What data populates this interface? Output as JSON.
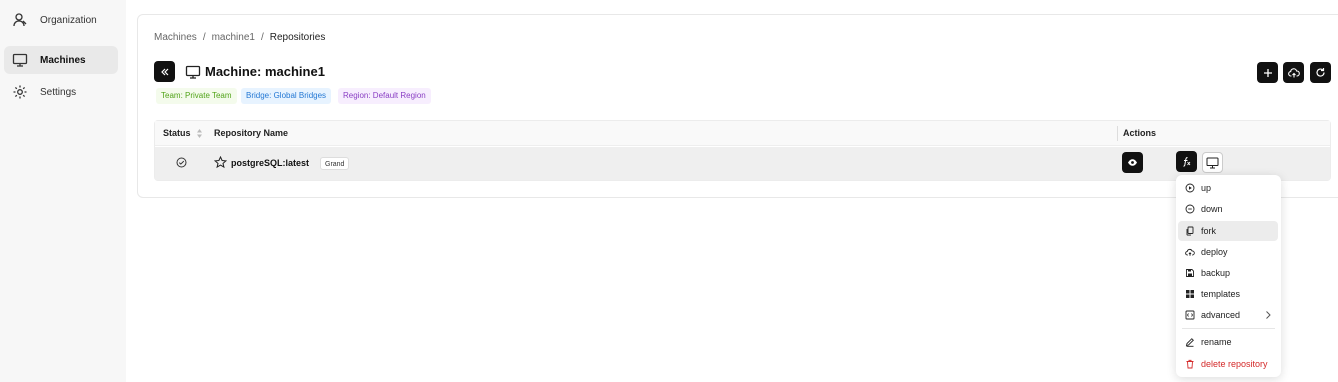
{
  "sidebar": {
    "items": [
      {
        "label": "Organization",
        "icon": "organization-icon",
        "active": false
      },
      {
        "label": "Machines",
        "icon": "monitor-icon",
        "active": true
      },
      {
        "label": "Settings",
        "icon": "gear-icon",
        "active": false
      }
    ]
  },
  "breadcrumb": {
    "items": [
      "Machines",
      "machine1",
      "Repositories"
    ],
    "separator": "/"
  },
  "header": {
    "title": "Machine: machine1",
    "tags": {
      "team": "Team: Private Team",
      "bridge": "Bridge: Global Bridges",
      "region": "Region: Default Region"
    },
    "buttons": [
      "add-icon",
      "cloud-upload-icon",
      "refresh-icon"
    ]
  },
  "table": {
    "columns": {
      "status": "Status",
      "name": "Repository Name",
      "actions": "Actions"
    },
    "rows": [
      {
        "name": "postgreSQL:latest",
        "badge": "Grand",
        "status_icon": "check-circle-icon"
      }
    ]
  },
  "menu": {
    "items": [
      {
        "label": "up",
        "icon": "play-circle-icon"
      },
      {
        "label": "down",
        "icon": "pause-circle-icon"
      },
      {
        "label": "fork",
        "icon": "copy-icon",
        "highlighted": true
      },
      {
        "label": "deploy",
        "icon": "cloud-icon"
      },
      {
        "label": "backup",
        "icon": "save-icon"
      },
      {
        "label": "templates",
        "icon": "grid-icon"
      },
      {
        "label": "advanced",
        "icon": "code-icon",
        "submenu": true
      },
      {
        "label": "rename",
        "icon": "edit-icon"
      },
      {
        "label": "delete repository",
        "icon": "trash-icon",
        "danger": true
      }
    ]
  },
  "colors": {
    "accent": "#111111",
    "danger": "#d42a2a"
  }
}
